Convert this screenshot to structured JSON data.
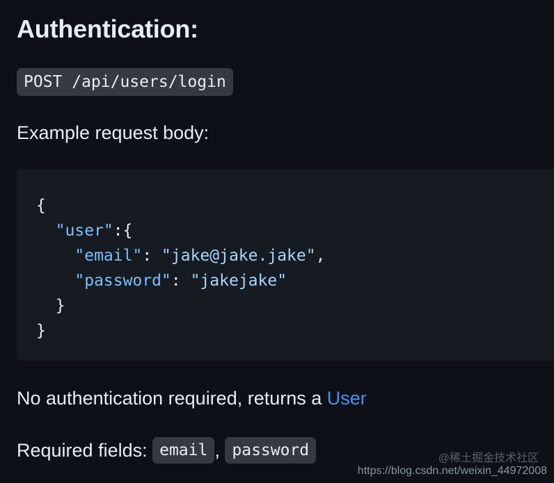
{
  "heading": "Authentication:",
  "endpoint": "POST /api/users/login",
  "example_label": "Example request body:",
  "code": {
    "lines": [
      {
        "parts": [
          {
            "text": "{",
            "type": "plain"
          }
        ]
      },
      {
        "parts": [
          {
            "text": "  ",
            "type": "plain"
          },
          {
            "text": "\"user\"",
            "type": "key"
          },
          {
            "text": ":{",
            "type": "plain"
          }
        ]
      },
      {
        "parts": [
          {
            "text": "    ",
            "type": "plain"
          },
          {
            "text": "\"email\"",
            "type": "key"
          },
          {
            "text": ": ",
            "type": "plain"
          },
          {
            "text": "\"jake@jake.jake\"",
            "type": "str"
          },
          {
            "text": ",",
            "type": "plain"
          }
        ]
      },
      {
        "parts": [
          {
            "text": "    ",
            "type": "plain"
          },
          {
            "text": "\"password\"",
            "type": "key"
          },
          {
            "text": ": ",
            "type": "plain"
          },
          {
            "text": "\"jakejake\"",
            "type": "str"
          }
        ]
      },
      {
        "parts": [
          {
            "text": "  }",
            "type": "plain"
          }
        ]
      },
      {
        "parts": [
          {
            "text": "}",
            "type": "plain"
          }
        ]
      }
    ]
  },
  "noauth": {
    "prefix": "No authentication required, returns a ",
    "link": "User"
  },
  "required": {
    "label": "Required fields: ",
    "field1": "email",
    "separator": ", ",
    "field2": "password"
  },
  "watermark": {
    "line1": "@稀土掘金技术社区",
    "line2": "https://blog.csdn.net/weixin_44972008"
  },
  "colors": {
    "background": "#0d1117",
    "code_background": "#161b22",
    "inline_code_background": "#343942",
    "link": "#4493f8",
    "json_key": "#79c0ff",
    "json_string": "#a5d6ff"
  }
}
